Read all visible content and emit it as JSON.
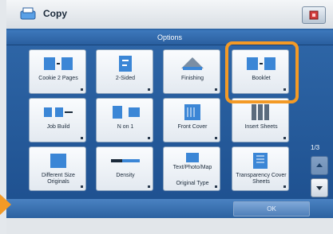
{
  "app": {
    "title": "Copy"
  },
  "panel": {
    "title": "Options"
  },
  "tiles": [
    {
      "label": "Cookie 2 Pages"
    },
    {
      "label": "2-Sided"
    },
    {
      "label": "Finishing"
    },
    {
      "label": "Booklet"
    },
    {
      "label": "Job Build"
    },
    {
      "label": "N on 1"
    },
    {
      "label": "Front Cover"
    },
    {
      "label": "Insert Sheets"
    },
    {
      "label": "Different Size Originals"
    },
    {
      "label": "Density"
    },
    {
      "label": "Original Type"
    },
    {
      "label": "Transparency Cover Sheets"
    }
  ],
  "tile_icons": [
    "copy-2pages-icon",
    "two-sided-icon",
    "finishing-icon",
    "booklet-icon",
    "job-build-icon",
    "n-on-1-icon",
    "front-cover-icon",
    "insert-sheets-icon",
    "different-size-originals-icon",
    "density-icon",
    "original-type-icon",
    "transparency-cover-icon"
  ],
  "tile_sublabels": {
    "original_type": "Text/Photo/Map"
  },
  "pagination": {
    "indicator": "1/3"
  },
  "footer": {
    "ok_label": "OK"
  },
  "colors": {
    "accent_highlight": "#f39a26",
    "panel_blue": "#2f67a8",
    "tile_bg": "#f3f6f9"
  }
}
